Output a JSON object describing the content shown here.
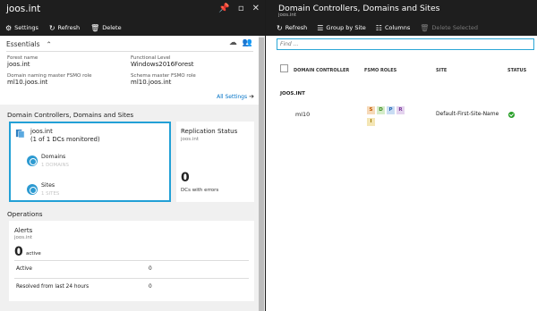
{
  "left_blade": {
    "title": "joos.int",
    "toolbar": {
      "settings_label": "Settings",
      "refresh_label": "Refresh",
      "delete_label": "Delete"
    },
    "essentials": {
      "title": "Essentials",
      "forest_name_key": "Forest name",
      "forest_name_value": "joos.int",
      "functional_level_key": "Functional Level",
      "functional_level_value": "Windows2016Forest",
      "domain_master_key": "Domain naming master FSMO role",
      "domain_master_value": "ml10.joos.int",
      "schema_master_key": "Schema master FSMO role",
      "schema_master_value": "ml10.joos.int",
      "all_settings_label": "All Settings"
    },
    "dc_section_title": "Domain Controllers, Domains and Sites",
    "dc_tile": {
      "name": "joos.int",
      "summary": "(1 of 1 DCs monitored)",
      "domains_label": "Domains",
      "domains_count": "1 DOMAINS",
      "sites_label": "Sites",
      "sites_count": "1 SITES"
    },
    "replication_tile": {
      "title": "Replication Status",
      "subtitle": "joos.int",
      "number": "0",
      "caption": "DCs with errors"
    },
    "operations_title": "Operations",
    "alerts_tile": {
      "title": "Alerts",
      "subtitle": "joos.int",
      "number": "0",
      "number_caption": "active",
      "rows": [
        {
          "label": "Active",
          "value": "0"
        },
        {
          "label": "Resolved from last 24 hours",
          "value": "0"
        }
      ]
    }
  },
  "right_blade": {
    "title": "Domain Controllers, Domains and Sites",
    "subtitle": "joos.int",
    "toolbar": {
      "refresh_label": "Refresh",
      "group_by_site_label": "Group by Site",
      "columns_label": "Columns",
      "delete_selected_label": "Delete Selected"
    },
    "find_placeholder": "Find ...",
    "columns": [
      "DOMAIN CONTROLLER",
      "FSMO ROLES",
      "SITE",
      "STATUS"
    ],
    "group_label": "JOOS.INT",
    "rows": [
      {
        "dc": "ml10",
        "fsmo": [
          "S",
          "D",
          "P",
          "R",
          "I"
        ],
        "site": "Default-First-Site-Name"
      }
    ]
  },
  "colors": {
    "title_bar": "#1e1e1e",
    "accent_blue": "#22a0d6",
    "link": "#0072c6",
    "status_ok": "#2aa02a",
    "fsmo_S": "#f6d9b8",
    "fsmo_D": "#d5ecc9",
    "fsmo_P": "#c9dcf3",
    "fsmo_R": "#e4d3ee",
    "fsmo_I": "#f4e6b5"
  }
}
